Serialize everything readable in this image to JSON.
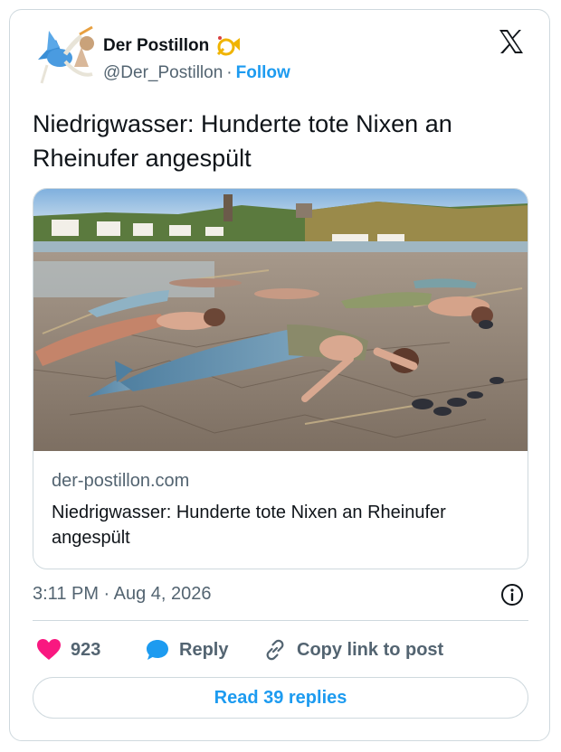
{
  "author": {
    "name": "Der Postillon",
    "handle": "@Der_Postillon",
    "separator": "·",
    "follow_label": "Follow"
  },
  "tweet": {
    "text": "Niedrigwasser: Hunderte tote Nixen an Rheinufer angespült"
  },
  "link_card": {
    "domain": "der-postillon.com",
    "title": "Niedrigwasser: Hunderte tote Nixen an Rheinufer angespült",
    "image": "photo of mermaids lying on dried Rhine riverbank"
  },
  "meta": {
    "timestamp": "3:11 PM · Aug 4, 2026"
  },
  "actions": {
    "likes": "923",
    "reply_label": "Reply",
    "copy_label": "Copy link to post"
  },
  "footer": {
    "read_replies_label": "Read 39 replies"
  },
  "colors": {
    "accent": "#1d9bf0",
    "heart": "#f91880",
    "muted": "#536471",
    "border": "#cfd9de"
  },
  "icons": [
    "stork-avatar-icon",
    "post-horn-icon",
    "x-logo-icon",
    "info-icon",
    "heart-icon",
    "reply-bubble-icon",
    "link-icon"
  ]
}
